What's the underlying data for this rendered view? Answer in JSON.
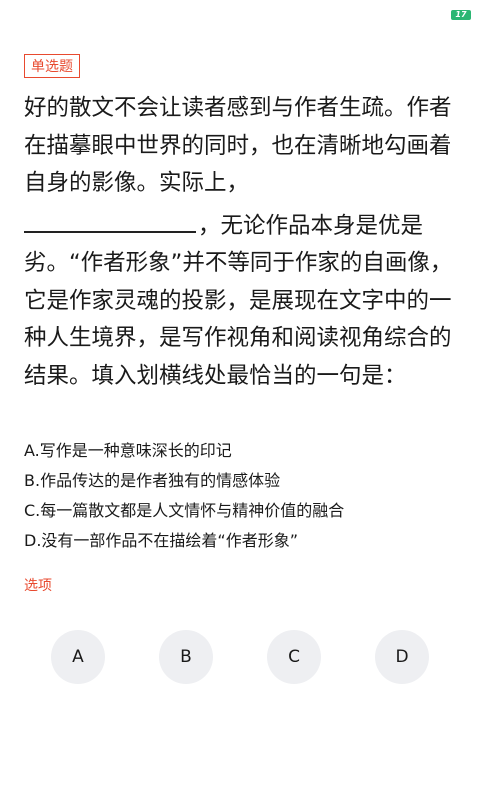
{
  "status_bar": {
    "battery_text": "17"
  },
  "question": {
    "type_tag": "单选题",
    "text_before_blank": "好的散文不会让读者感到与作者生疏。作者在描摹眼中世界的同时，也在清晰地勾画着自身的影像。实际上，",
    "text_after_blank": "，无论作品本身是优是劣。“作者形象”并不等同于作家的自画像，它是作家灵魂的投影，是展现在文字中的一种人生境界，是写作视角和阅读视角综合的结果。填入划横线处最恰当的一句是：",
    "options": [
      "A.写作是一种意味深长的印记",
      "B.作品传达的是作者独有的情感体验",
      "C.每一篇散文都是人文情怀与精神价值的融合",
      "D.没有一部作品不在描绘着“作者形象”"
    ]
  },
  "answer_section": {
    "label": "选项",
    "choices": [
      "A",
      "B",
      "C",
      "D"
    ]
  }
}
